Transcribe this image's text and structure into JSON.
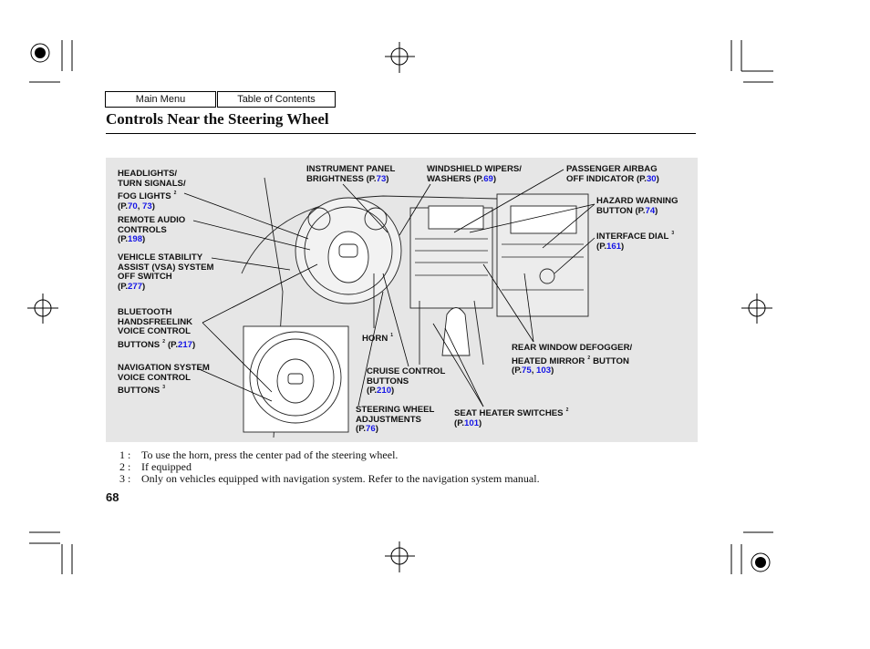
{
  "nav": {
    "main_menu": "Main Menu",
    "toc": "Table of Contents"
  },
  "title": "Controls Near the Steering Wheel",
  "callouts": {
    "headlights": {
      "lines": [
        "HEADLIGHTS/",
        "TURN SIGNALS/",
        "FOG LIGHTS"
      ],
      "sup": "2",
      "pages": [
        "70",
        "73"
      ]
    },
    "remote_audio": {
      "lines": [
        "REMOTE AUDIO",
        "CONTROLS"
      ],
      "pages": [
        "198"
      ]
    },
    "vsa": {
      "lines": [
        "VEHICLE STABILITY",
        "ASSIST (VSA) SYSTEM",
        "OFF SWITCH"
      ],
      "pages": [
        "277"
      ]
    },
    "bluetooth": {
      "lines": [
        "BLUETOOTH",
        "HANDSFREELINK",
        "VOICE CONTROL",
        "BUTTONS"
      ],
      "sup": "2",
      "pages": [
        "217"
      ]
    },
    "navigation": {
      "lines": [
        "NAVIGATION SYSTEM",
        "VOICE CONTROL",
        "BUTTONS"
      ],
      "sup": "3"
    },
    "instrument": {
      "lines": [
        "INSTRUMENT PANEL",
        "BRIGHTNESS"
      ],
      "pages": [
        "73"
      ]
    },
    "wipers": {
      "lines": [
        "WINDSHIELD WIPERS/",
        "WASHERS"
      ],
      "pages": [
        "69"
      ]
    },
    "airbag": {
      "lines": [
        "PASSENGER AIRBAG",
        "OFF INDICATOR"
      ],
      "pages": [
        "30"
      ]
    },
    "hazard": {
      "lines": [
        "HAZARD WARNING",
        "BUTTON"
      ],
      "pages": [
        "74"
      ]
    },
    "interface": {
      "lines": [
        "INTERFACE DIAL"
      ],
      "sup": "3",
      "pages": [
        "161"
      ]
    },
    "horn": {
      "lines": [
        "HORN"
      ],
      "sup": "1"
    },
    "defogger": {
      "lines": [
        "REAR WINDOW DEFOGGER/",
        "HEATED MIRROR",
        "BUTTON"
      ],
      "sup": "2",
      "pages": [
        "75",
        "103"
      ]
    },
    "cruise": {
      "lines": [
        "CRUISE CONTROL",
        "BUTTONS"
      ],
      "pages": [
        "210"
      ]
    },
    "steering": {
      "lines": [
        "STEERING WHEEL",
        "ADJUSTMENTS"
      ],
      "pages": [
        "76"
      ]
    },
    "seat": {
      "lines": [
        "SEAT HEATER SWITCHES"
      ],
      "sup": "2",
      "pages": [
        "101"
      ]
    }
  },
  "page_prefix": "(P.",
  "footnotes": [
    {
      "num": "1 :",
      "text": "To use the horn, press the center pad of the steering wheel."
    },
    {
      "num": "2 :",
      "text": "If equipped"
    },
    {
      "num": "3 :",
      "text": "Only on vehicles equipped with navigation system. Refer to the navigation system manual."
    }
  ],
  "page_number": "68",
  "colors": {
    "link": "#1515e6",
    "panel": "#e6e6e6"
  }
}
